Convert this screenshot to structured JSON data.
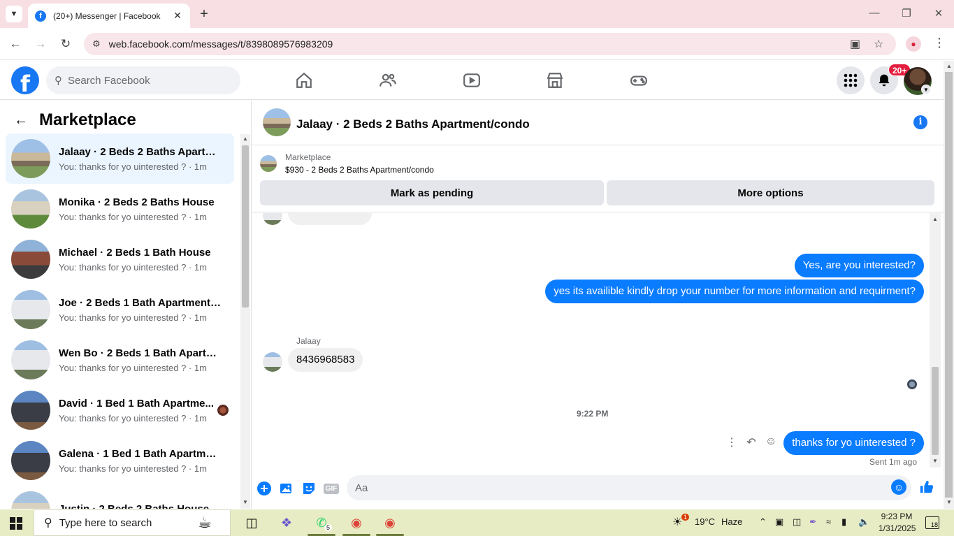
{
  "browser": {
    "tab_title": "(20+) Messenger | Facebook",
    "url": "web.facebook.com/messages/t/8398089576983209"
  },
  "header": {
    "search_placeholder": "Search Facebook",
    "notification_badge": "20+"
  },
  "left_panel": {
    "title": "Marketplace",
    "conversations": [
      {
        "name": "Jalaay · 2 Beds 2 Baths Apartme...",
        "preview": "You: thanks for yo uinterested ? · 1m"
      },
      {
        "name": "Monika · 2 Beds 2 Baths House",
        "preview": "You: thanks for yo uinterested ? · 1m"
      },
      {
        "name": "Michael · 2 Beds 1 Bath House",
        "preview": "You: thanks for yo uinterested ? · 1m"
      },
      {
        "name": "Joe · 2 Beds 1 Bath Apartment/c...",
        "preview": "You: thanks for yo uinterested ? · 1m"
      },
      {
        "name": "Wen Bo · 2 Beds 1 Bath Apartme...",
        "preview": "You: thanks for yo uinterested ? · 1m"
      },
      {
        "name": "David · 1 Bed 1 Bath Apartme...",
        "preview": "You: thanks for yo uinterested ? · 1m"
      },
      {
        "name": "Galena · 1 Bed 1 Bath Apartment...",
        "preview": "You: thanks for yo uinterested ? · 1m"
      },
      {
        "name": "Justin · 2 Beds 2 Baths House",
        "preview": ""
      }
    ]
  },
  "chat": {
    "title": "Jalaay · 2 Beds 2 Baths Apartment/condo",
    "listing_label": "Marketplace",
    "listing_price": "$930 - 2 Beds 2 Baths Apartment/condo",
    "btn_pending": "Mark as pending",
    "btn_more": "More options",
    "messages": {
      "out1": "Yes, are you interested?",
      "out2": "yes its availible kindly drop your number for more information and requirment?",
      "sender": "Jalaay",
      "in1": "8436968583",
      "timestamp": "9:22 PM",
      "out3": "thanks for yo uinterested ?",
      "sent": "Sent 1m ago"
    },
    "composer_placeholder": "Aa",
    "gif_label": "GIF"
  },
  "taskbar": {
    "search_placeholder": "Type here to search",
    "weather_temp": "19°C",
    "weather_text": "Haze",
    "weather_alert": "1",
    "time": "9:23 PM",
    "date": "1/31/2025",
    "notifications": "18",
    "whatsapp_count": "5"
  }
}
